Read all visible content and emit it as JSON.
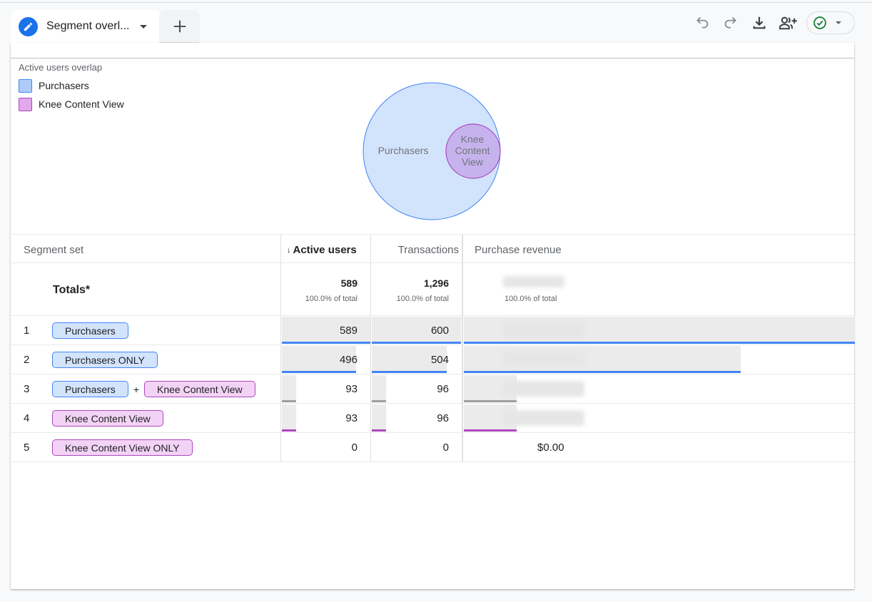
{
  "tabs": {
    "active": {
      "label": "Segment overl...",
      "icon": "pencil-icon"
    },
    "add": {
      "icon": "plus-icon"
    }
  },
  "toolbar": {
    "undo": "undo-icon",
    "redo": "redo-icon",
    "download": "download-icon",
    "share": "share-user-icon",
    "status": "check-circle-icon"
  },
  "colors": {
    "accent": "#1a73e8",
    "purchasers": "#4285f4",
    "purchasers_fill": "#d2e3fc",
    "knee": "#ab47bc",
    "knee_fill": "#f3d3f5",
    "overlap_bar": "#9e9e9e",
    "status_green": "#188038"
  },
  "legend": {
    "title": "Active users overlap",
    "items": [
      {
        "label": "Purchasers",
        "color": "#aecbfa",
        "border": "#4285f4"
      },
      {
        "label": "Knee Content View",
        "color": "#e1a8ec",
        "border": "#ab47bc"
      }
    ]
  },
  "venn": {
    "circles": [
      {
        "label": "Purchasers",
        "value": 589
      },
      {
        "label_lines": [
          "Knee",
          "Content",
          "View"
        ],
        "value": 93
      }
    ],
    "overlap": 93
  },
  "table": {
    "headers": {
      "segment": "Segment set",
      "active_users": "Active users",
      "transactions": "Transactions",
      "revenue": "Purchase revenue",
      "sort_arrow": "↓"
    },
    "totals": {
      "label": "Totals*",
      "active_users": "589",
      "active_users_pct": "100.0% of total",
      "transactions": "1,296",
      "transactions_pct": "100.0% of total",
      "revenue_pct": "100.0% of total"
    },
    "rows": [
      {
        "num": "1",
        "chips": [
          {
            "label": "Purchasers",
            "type": "blue"
          }
        ],
        "active_users": "589",
        "transactions": "600",
        "au_frac": 1.0,
        "tr_frac": 1.0,
        "rev_frac": 1.0,
        "bar": "blue",
        "revenue": ""
      },
      {
        "num": "2",
        "chips": [
          {
            "label": "Purchasers ONLY",
            "type": "blue"
          }
        ],
        "active_users": "496",
        "transactions": "504",
        "au_frac": 0.842,
        "tr_frac": 0.84,
        "rev_frac": 0.84,
        "bar": "blue",
        "revenue": ""
      },
      {
        "num": "3",
        "chips": [
          {
            "label": "Purchasers",
            "type": "blue"
          },
          {
            "label": "Knee Content View",
            "type": "purple"
          }
        ],
        "plus": "+",
        "active_users": "93",
        "transactions": "96",
        "au_frac": 0.158,
        "tr_frac": 0.16,
        "rev_frac": 0.16,
        "bar": "gray",
        "revenue": ""
      },
      {
        "num": "4",
        "chips": [
          {
            "label": "Knee Content View",
            "type": "purple"
          }
        ],
        "active_users": "93",
        "transactions": "96",
        "au_frac": 0.158,
        "tr_frac": 0.16,
        "rev_frac": 0.16,
        "bar": "purple",
        "revenue": ""
      },
      {
        "num": "5",
        "chips": [
          {
            "label": "Knee Content View ONLY",
            "type": "purple"
          }
        ],
        "active_users": "0",
        "transactions": "0",
        "au_frac": 0,
        "tr_frac": 0,
        "rev_frac": 0,
        "bar": "none",
        "revenue": "$0.00"
      }
    ]
  }
}
